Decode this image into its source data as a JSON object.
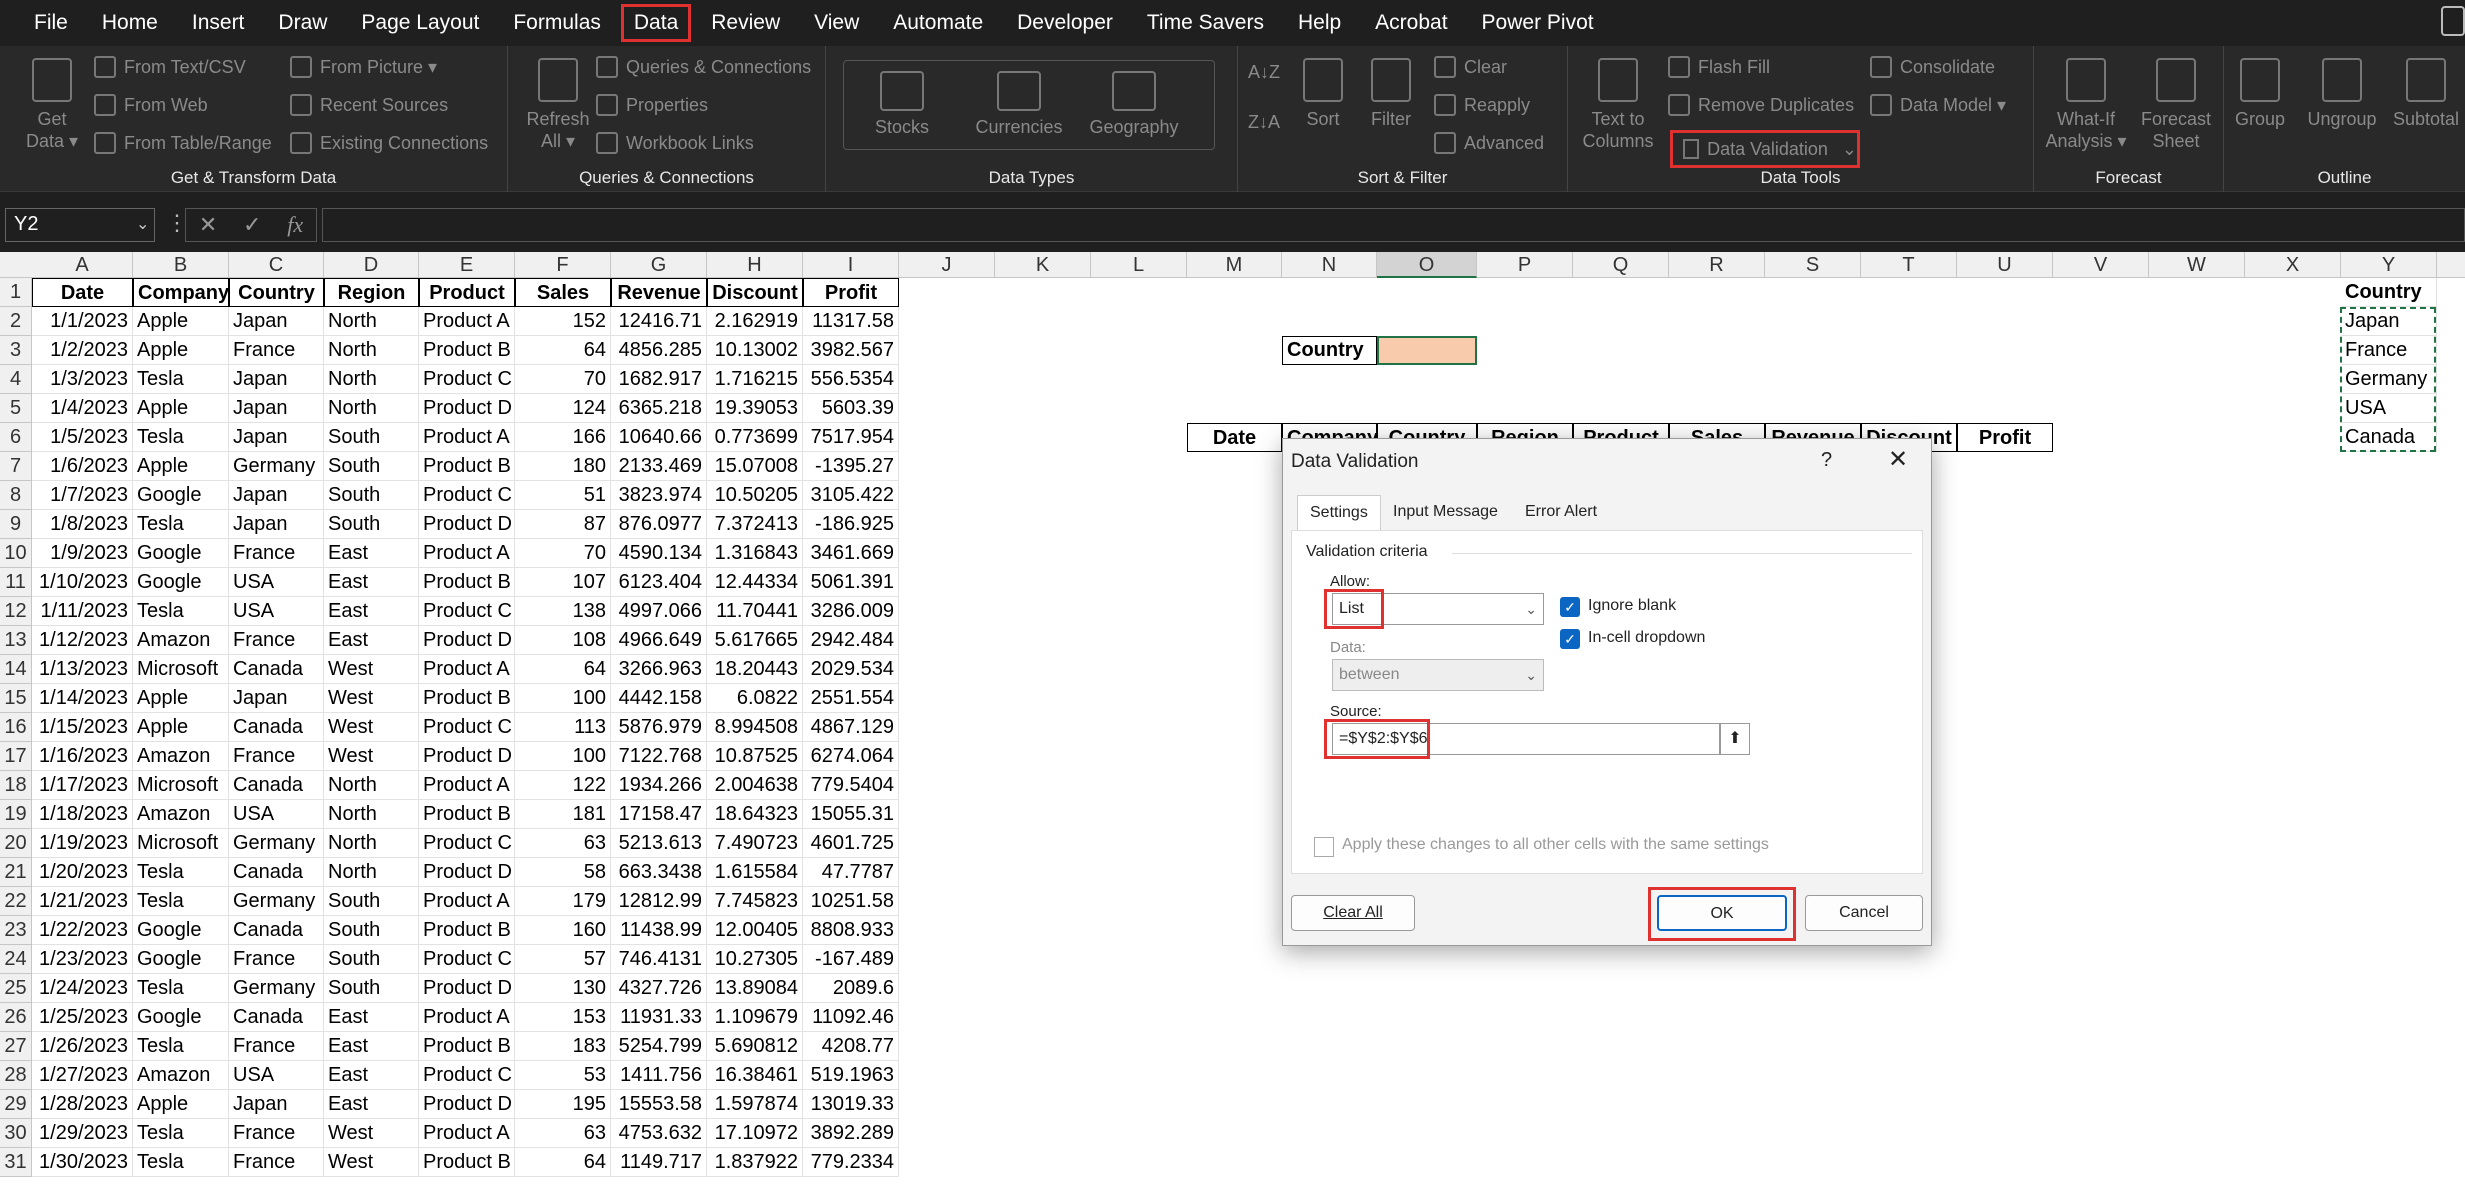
{
  "menu": [
    "File",
    "Home",
    "Insert",
    "Draw",
    "Page Layout",
    "Formulas",
    "Data",
    "Review",
    "View",
    "Automate",
    "Developer",
    "Time Savers",
    "Help",
    "Acrobat",
    "Power Pivot"
  ],
  "active_menu": "Data",
  "ribbon": {
    "groups": {
      "get_transform": "Get & Transform Data",
      "queries": "Queries & Connections",
      "data_types": "Data Types",
      "sort_filter": "Sort & Filter",
      "data_tools": "Data Tools",
      "forecast": "Forecast",
      "outline": "Outline"
    },
    "get_data": "Get Data ▾",
    "from_text": "From Text/CSV",
    "from_web": "From Web",
    "from_table": "From Table/Range",
    "from_picture": "From Picture ▾",
    "recent_sources": "Recent Sources",
    "existing_connections": "Existing Connections",
    "refresh_all": "Refresh All ▾",
    "queries_connections": "Queries & Connections",
    "properties": "Properties",
    "workbook_links": "Workbook Links",
    "stocks": "Stocks",
    "currencies": "Currencies",
    "geography": "Geography",
    "sort_az": "A↓Z",
    "sort_za": "Z↓A",
    "sort": "Sort",
    "filter": "Filter",
    "clear": "Clear",
    "reapply": "Reapply",
    "advanced": "Advanced",
    "text_to_columns": "Text to Columns",
    "flash_fill": "Flash Fill",
    "remove_duplicates": "Remove Duplicates",
    "data_validation": "Data Validation",
    "consolidate": "Consolidate",
    "data_model": "Data Model ▾",
    "what_if": "What-If Analysis ▾",
    "forecast_sheet": "Forecast Sheet",
    "group": "Group",
    "ungroup": "Ungroup",
    "subtotal": "Subtotal"
  },
  "formula_bar": {
    "name_box": "Y2",
    "fx": "fx",
    "cancel": "✕",
    "enter": "✓",
    "formula": ""
  },
  "columns": [
    "A",
    "B",
    "C",
    "D",
    "E",
    "F",
    "G",
    "H",
    "I",
    "J",
    "K",
    "L",
    "M",
    "N",
    "O",
    "P",
    "Q",
    "R",
    "S",
    "T",
    "U",
    "V",
    "W",
    "X",
    "Y"
  ],
  "rows": [
    "1",
    "2",
    "3",
    "4",
    "5",
    "6",
    "7",
    "8",
    "9",
    "10",
    "11",
    "12",
    "13",
    "14",
    "15",
    "16",
    "17",
    "18",
    "19",
    "20",
    "21",
    "22",
    "23",
    "24",
    "25",
    "26",
    "27",
    "28",
    "29",
    "30",
    "31"
  ],
  "table_headers": [
    "Date",
    "Company",
    "Country",
    "Region",
    "Product",
    "Sales",
    "Revenue",
    "Discount",
    "Profit"
  ],
  "table_rows": [
    [
      "1/1/2023",
      "Apple",
      "Japan",
      "North",
      "Product A",
      "152",
      "12416.71",
      "2.162919",
      "11317.58"
    ],
    [
      "1/2/2023",
      "Apple",
      "France",
      "North",
      "Product B",
      "64",
      "4856.285",
      "10.13002",
      "3982.567"
    ],
    [
      "1/3/2023",
      "Tesla",
      "Japan",
      "North",
      "Product C",
      "70",
      "1682.917",
      "1.716215",
      "556.5354"
    ],
    [
      "1/4/2023",
      "Apple",
      "Japan",
      "North",
      "Product D",
      "124",
      "6365.218",
      "19.39053",
      "5603.39"
    ],
    [
      "1/5/2023",
      "Tesla",
      "Japan",
      "South",
      "Product A",
      "166",
      "10640.66",
      "0.773699",
      "7517.954"
    ],
    [
      "1/6/2023",
      "Apple",
      "Germany",
      "South",
      "Product B",
      "180",
      "2133.469",
      "15.07008",
      "-1395.27"
    ],
    [
      "1/7/2023",
      "Google",
      "Japan",
      "South",
      "Product C",
      "51",
      "3823.974",
      "10.50205",
      "3105.422"
    ],
    [
      "1/8/2023",
      "Tesla",
      "Japan",
      "South",
      "Product D",
      "87",
      "876.0977",
      "7.372413",
      "-186.925"
    ],
    [
      "1/9/2023",
      "Google",
      "France",
      "East",
      "Product A",
      "70",
      "4590.134",
      "1.316843",
      "3461.669"
    ],
    [
      "1/10/2023",
      "Google",
      "USA",
      "East",
      "Product B",
      "107",
      "6123.404",
      "12.44334",
      "5061.391"
    ],
    [
      "1/11/2023",
      "Tesla",
      "USA",
      "East",
      "Product C",
      "138",
      "4997.066",
      "11.70441",
      "3286.009"
    ],
    [
      "1/12/2023",
      "Amazon",
      "France",
      "East",
      "Product D",
      "108",
      "4966.649",
      "5.617665",
      "2942.484"
    ],
    [
      "1/13/2023",
      "Microsoft",
      "Canada",
      "West",
      "Product A",
      "64",
      "3266.963",
      "18.20443",
      "2029.534"
    ],
    [
      "1/14/2023",
      "Apple",
      "Japan",
      "West",
      "Product B",
      "100",
      "4442.158",
      "6.0822",
      "2551.554"
    ],
    [
      "1/15/2023",
      "Apple",
      "Canada",
      "West",
      "Product C",
      "113",
      "5876.979",
      "8.994508",
      "4867.129"
    ],
    [
      "1/16/2023",
      "Amazon",
      "France",
      "West",
      "Product D",
      "100",
      "7122.768",
      "10.87525",
      "6274.064"
    ],
    [
      "1/17/2023",
      "Microsoft",
      "Canada",
      "North",
      "Product A",
      "122",
      "1934.266",
      "2.004638",
      "779.5404"
    ],
    [
      "1/18/2023",
      "Amazon",
      "USA",
      "North",
      "Product B",
      "181",
      "17158.47",
      "18.64323",
      "15055.31"
    ],
    [
      "1/19/2023",
      "Microsoft",
      "Germany",
      "North",
      "Product C",
      "63",
      "5213.613",
      "7.490723",
      "4601.725"
    ],
    [
      "1/20/2023",
      "Tesla",
      "Canada",
      "North",
      "Product D",
      "58",
      "663.3438",
      "1.615584",
      "47.7787"
    ],
    [
      "1/21/2023",
      "Tesla",
      "Germany",
      "South",
      "Product A",
      "179",
      "12812.99",
      "7.745823",
      "10251.58"
    ],
    [
      "1/22/2023",
      "Google",
      "Canada",
      "South",
      "Product B",
      "160",
      "11438.99",
      "12.00405",
      "8808.933"
    ],
    [
      "1/23/2023",
      "Google",
      "France",
      "South",
      "Product C",
      "57",
      "746.4131",
      "10.27305",
      "-167.489"
    ],
    [
      "1/24/2023",
      "Tesla",
      "Germany",
      "South",
      "Product D",
      "130",
      "4327.726",
      "13.89084",
      "2089.6"
    ],
    [
      "1/25/2023",
      "Google",
      "Canada",
      "East",
      "Product A",
      "153",
      "11931.33",
      "1.109679",
      "11092.46"
    ],
    [
      "1/26/2023",
      "Tesla",
      "France",
      "East",
      "Product B",
      "183",
      "5254.799",
      "5.690812",
      "4208.77"
    ],
    [
      "1/27/2023",
      "Amazon",
      "USA",
      "East",
      "Product C",
      "53",
      "1411.756",
      "16.38461",
      "519.1963"
    ],
    [
      "1/28/2023",
      "Apple",
      "Japan",
      "East",
      "Product D",
      "195",
      "15553.58",
      "1.597874",
      "13019.33"
    ],
    [
      "1/29/2023",
      "Tesla",
      "France",
      "West",
      "Product A",
      "63",
      "4753.632",
      "17.10972",
      "3892.289"
    ],
    [
      "1/30/2023",
      "Tesla",
      "France",
      "West",
      "Product B",
      "64",
      "1149.717",
      "1.837922",
      "779.2334"
    ]
  ],
  "country_label": "Country",
  "second_table_headers": [
    "Date",
    "Company",
    "Country",
    "Region",
    "Product",
    "Sales",
    "Revenue",
    "Discount",
    "Profit"
  ],
  "country_list_header": "Country",
  "country_list": [
    "Japan",
    "France",
    "Germany",
    "USA",
    "Canada"
  ],
  "dialog": {
    "title": "Data Validation",
    "help": "?",
    "close": "✕",
    "tabs": [
      "Settings",
      "Input Message",
      "Error Alert"
    ],
    "validation_criteria": "Validation criteria",
    "allow_label": "Allow:",
    "allow_value": "List",
    "ignore_blank": "Ignore blank",
    "in_cell_dropdown": "In-cell dropdown",
    "data_label": "Data:",
    "data_value": "between",
    "source_label": "Source:",
    "source_value": "=$Y$2:$Y$6",
    "apply_all": "Apply these changes to all other cells with the same settings",
    "clear_all": "Clear All",
    "ok": "OK",
    "cancel": "Cancel"
  }
}
